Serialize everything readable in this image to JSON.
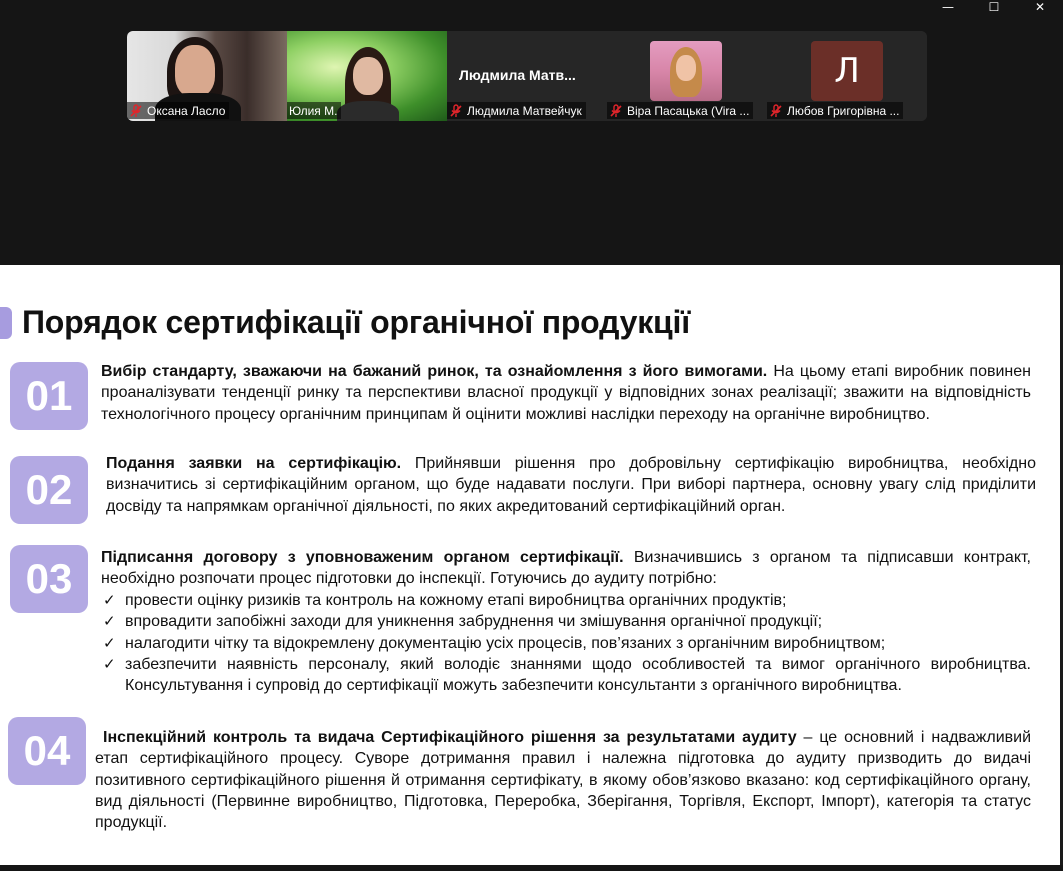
{
  "window": {
    "controls": [
      "—",
      "☐",
      "✕"
    ]
  },
  "participants": [
    {
      "name": "Оксана Ласло",
      "type": "video",
      "muted": true
    },
    {
      "name": "Юлия М.",
      "type": "video",
      "muted": false,
      "active_speaker": true
    },
    {
      "name": "Людмила Матвейчук",
      "display_name": "Людмила  Матв...",
      "type": "name",
      "muted": true
    },
    {
      "name": "Віра Пасацька (Vira ...",
      "type": "photo",
      "muted": true
    },
    {
      "name": "Любов Григорівна ...",
      "type": "avatar",
      "avatar_letter": "Л",
      "avatar_color": "#6b2f28",
      "muted": true
    }
  ],
  "colors": {
    "accent": "#b3a9e3",
    "active_border": "#23d96b",
    "muted_icon": "#e0252b"
  },
  "slide": {
    "title": "Порядок сертифікації органічної продукції",
    "steps": [
      {
        "number": "01",
        "heading": "Вибір стандарту, зважаючи на бажаний ринок, та ознайомлення з його вимогами.",
        "text": " На цьому етапі виробник повинен проаналізувати тенденції ринку та перспективи власної продукції у відповідних зонах реалізації; зважити на відповідність технологічного процесу органічним принципам й оцінити можливі наслідки переходу на органічне виробництво."
      },
      {
        "number": "02",
        "heading": "Подання заявки на сертифікацію.",
        "text": " Прийнявши рішення про добровільну сертифікацію виробництва, необхідно визначитись зі сертифікаційним органом, що буде надавати послуги. При виборі партнера, основну увагу слід приділити досвіду та напрямкам органічної діяльності, по яких акредитований сертифікаційний орган."
      },
      {
        "number": "03",
        "heading": "Підписання договору з уповноваженим органом сертифікації.",
        "text": " Визначившись з органом та підписавши контракт, необхідно розпочати процес підготовки до інспекції. Готуючись до аудиту потрібно:",
        "checklist": [
          "провести оцінку ризиків та контроль на кожному етапі виробництва органічних продуктів;",
          "впровадити запобіжні заходи для уникнення забруднення чи змішування органічної продукції;",
          "налагодити чітку та відокремлену документацію усіх процесів, пов’язаних з органічним виробництвом;",
          "забезпечити наявність персоналу, який володіє знаннями щодо особливостей та вимог органічного виробництва. Консультування і супровід до сертифікації можуть забезпечити консультанти з органічного виробництва."
        ]
      },
      {
        "number": "04",
        "heading": "Інспекційний контроль та видача Сертифікаційного рішення за результатами аудиту",
        "text": " – це основний і надважливий етап сертифікаційного процесу. Суворе дотримання правил і належна підготовка до аудиту призводить до видачі позитивного сертифікаційного рішення й отримання сертифікату, в якому обов’язково вказано: код сертифікаційного органу, вид діяльності (Первинне виробництво, Підготовка, Переробка, Зберігання, Торгівля, Експорт, Імпорт), категорія та статус продукції."
      }
    ]
  }
}
